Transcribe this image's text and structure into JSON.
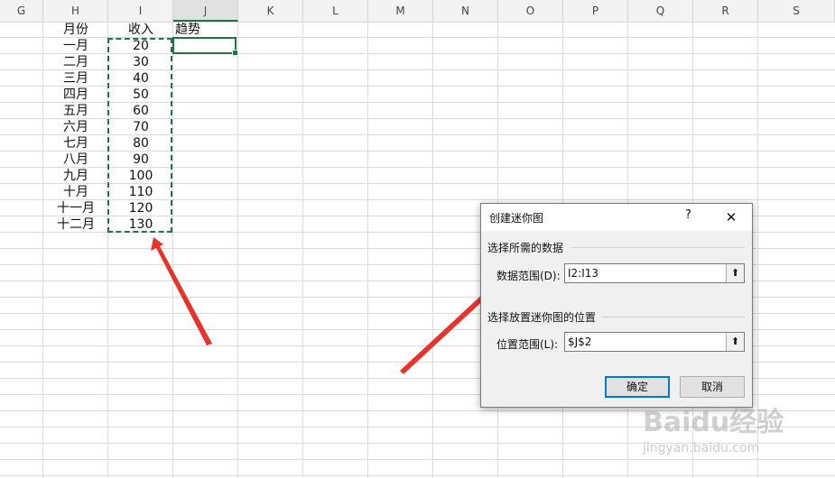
{
  "columns": [
    "G",
    "H",
    "I",
    "J",
    "K",
    "L",
    "M",
    "N",
    "O",
    "P",
    "Q",
    "R",
    "S"
  ],
  "active_column": "J",
  "header_row": {
    "month": "月份",
    "income": "收入",
    "trend": "趋势"
  },
  "rows": [
    {
      "month": "一月",
      "income": "20"
    },
    {
      "month": "二月",
      "income": "30"
    },
    {
      "month": "三月",
      "income": "40"
    },
    {
      "month": "四月",
      "income": "50"
    },
    {
      "month": "五月",
      "income": "60"
    },
    {
      "month": "六月",
      "income": "70"
    },
    {
      "month": "七月",
      "income": "80"
    },
    {
      "month": "八月",
      "income": "90"
    },
    {
      "month": "九月",
      "income": "100"
    },
    {
      "month": "十月",
      "income": "110"
    },
    {
      "month": "十一月",
      "income": "120"
    },
    {
      "month": "十二月",
      "income": "130"
    }
  ],
  "dialog": {
    "title": "创建迷你图",
    "help": "?",
    "close": "✕",
    "section_data": "选择所需的数据",
    "data_range_label": "数据范围(D):",
    "data_range_value": "I2:I13",
    "section_location": "选择放置迷你图的位置",
    "location_range_label": "位置范围(L):",
    "location_range_value": "$J$2",
    "collapse_glyph": "⬆",
    "ok_label": "确定",
    "cancel_label": "取消"
  },
  "watermark": {
    "logo": "Baidu经验",
    "url": "jingyan.baidu.com"
  },
  "colors": {
    "accent": "#217346",
    "arrow": "#e8332a",
    "dialog_primary": "#0078d7"
  }
}
